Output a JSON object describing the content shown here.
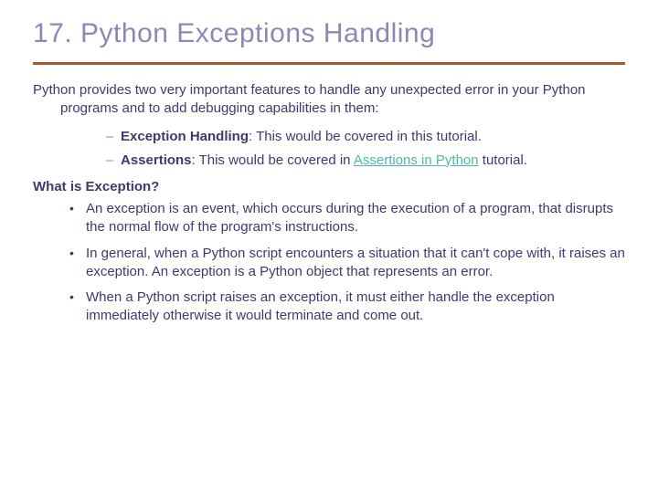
{
  "title": "17. Python Exceptions Handling",
  "intro": "Python provides two very important features to handle any unexpected error in your Python programs and to add debugging capabilities in them:",
  "sub1_bold": "Exception Handling",
  "sub1_rest": ": This would be covered in this tutorial.",
  "sub2_bold": "Assertions",
  "sub2_rest1": ": This would be covered in ",
  "sub2_link": "Assertions in Python",
  "sub2_rest2": " tutorial.",
  "heading2": "What is Exception?",
  "b1": "An exception is an event, which occurs during the execution of a program, that disrupts the normal flow of the program's instructions.",
  "b2": "In general, when a Python script encounters a situation that it can't cope with, it raises an exception. An exception is a Python object that represents an error.",
  "b3": "When a Python script raises an exception, it must either handle the exception immediately otherwise it would terminate and come out."
}
